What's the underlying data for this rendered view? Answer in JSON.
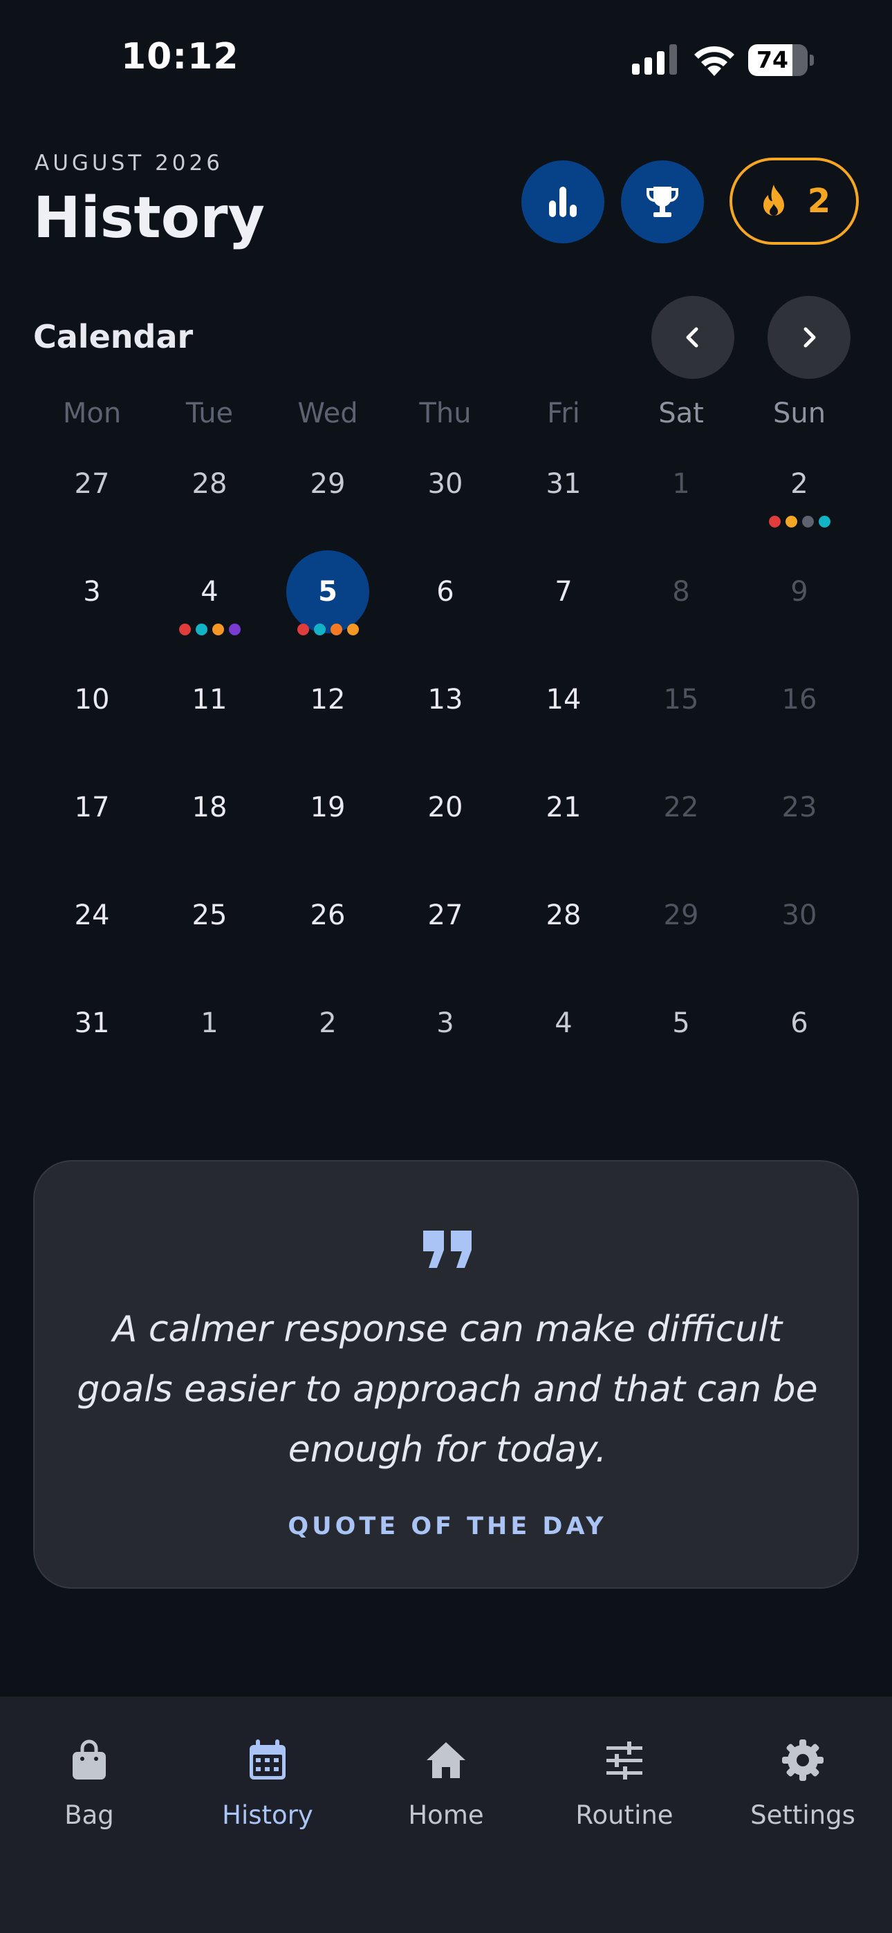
{
  "status_bar": {
    "time": "10:12",
    "battery": "74",
    "battery_level": 0.74
  },
  "header": {
    "month": "AUGUST 2026",
    "title": "History",
    "streak_count": "2"
  },
  "calendar": {
    "title": "Calendar",
    "weekdays": [
      "Mon",
      "Tue",
      "Wed",
      "Thu",
      "Fri",
      "Sat",
      "Sun"
    ],
    "weeks": [
      [
        {
          "d": "27",
          "s": "muted"
        },
        {
          "d": "28",
          "s": "muted"
        },
        {
          "d": "29",
          "s": "muted"
        },
        {
          "d": "30",
          "s": "muted"
        },
        {
          "d": "31",
          "s": "muted"
        },
        {
          "d": "1",
          "s": "dim"
        },
        {
          "d": "2",
          "s": "muted",
          "dots": [
            "#e03c3c",
            "#f5a623",
            "#5d6270",
            "#12b3c7"
          ]
        }
      ],
      [
        {
          "d": "3",
          "s": "normal"
        },
        {
          "d": "4",
          "s": "normal",
          "dots": [
            "#e03c3c",
            "#12b3c7",
            "#f59723",
            "#7a3bd1"
          ]
        },
        {
          "d": "5",
          "s": "selected",
          "dots": [
            "#e03c3c",
            "#12b3c7",
            "#f57a23",
            "#f59723"
          ]
        },
        {
          "d": "6",
          "s": "normal"
        },
        {
          "d": "7",
          "s": "normal"
        },
        {
          "d": "8",
          "s": "dim"
        },
        {
          "d": "9",
          "s": "dim"
        }
      ],
      [
        {
          "d": "10",
          "s": "normal"
        },
        {
          "d": "11",
          "s": "normal"
        },
        {
          "d": "12",
          "s": "normal"
        },
        {
          "d": "13",
          "s": "normal"
        },
        {
          "d": "14",
          "s": "normal"
        },
        {
          "d": "15",
          "s": "dim"
        },
        {
          "d": "16",
          "s": "dim"
        }
      ],
      [
        {
          "d": "17",
          "s": "normal"
        },
        {
          "d": "18",
          "s": "normal"
        },
        {
          "d": "19",
          "s": "normal"
        },
        {
          "d": "20",
          "s": "normal"
        },
        {
          "d": "21",
          "s": "normal"
        },
        {
          "d": "22",
          "s": "dim"
        },
        {
          "d": "23",
          "s": "dim"
        }
      ],
      [
        {
          "d": "24",
          "s": "normal"
        },
        {
          "d": "25",
          "s": "normal"
        },
        {
          "d": "26",
          "s": "normal"
        },
        {
          "d": "27",
          "s": "normal"
        },
        {
          "d": "28",
          "s": "normal"
        },
        {
          "d": "29",
          "s": "dim"
        },
        {
          "d": "30",
          "s": "dim"
        }
      ],
      [
        {
          "d": "31",
          "s": "normal"
        },
        {
          "d": "1",
          "s": "muted"
        },
        {
          "d": "2",
          "s": "muted"
        },
        {
          "d": "3",
          "s": "muted"
        },
        {
          "d": "4",
          "s": "muted"
        },
        {
          "d": "5",
          "s": "muted"
        },
        {
          "d": "6",
          "s": "muted"
        }
      ]
    ]
  },
  "quote": {
    "text": "A calmer response can make difficult goals easier to approach and that can be enough for today.",
    "label": "QUOTE OF THE DAY"
  },
  "nav": {
    "items": [
      {
        "label": "Bag",
        "icon": "bag-icon"
      },
      {
        "label": "History",
        "icon": "calendar-icon",
        "active": true
      },
      {
        "label": "Home",
        "icon": "home-icon"
      },
      {
        "label": "Routine",
        "icon": "sliders-icon"
      },
      {
        "label": "Settings",
        "icon": "gear-icon"
      }
    ]
  },
  "colors": {
    "accent": "#074187",
    "streak": "#f5a623",
    "active_nav": "#a9c4f5",
    "background": "#0d1118"
  }
}
